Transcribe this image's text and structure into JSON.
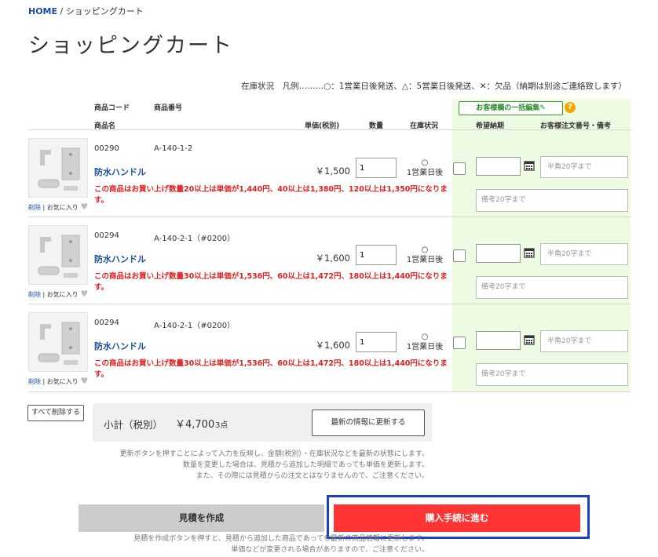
{
  "breadcrumb": {
    "home": "HOME",
    "sep": "/",
    "current": "ショッピングカート"
  },
  "title": "ショッピングカート",
  "legend": "在庫状況　凡例………○：1営業日後発送、△：5営業日後発送、✕：欠品（納期は別途ご連絡致します）",
  "headers": {
    "code": "商品コード",
    "number": "商品番号",
    "name": "商品名",
    "price": "単価(税別)",
    "qty": "数量",
    "stock": "在庫状況",
    "desired_date": "希望納期",
    "order_no": "お客様注文番号・備考",
    "bulk_edit": "お客様欄の一括編集✎",
    "help": "?"
  },
  "items": [
    {
      "code": "00290",
      "number": "A-140-1-2",
      "name": "防水ハンドル",
      "price": "￥1,500",
      "qty": "1",
      "stock_mark": "○",
      "stock_text": "1営業日後",
      "note": "この商品はお買い上げ数量20以上は単価が1,440円、40以上は1,380円、120以上は1,350円になります。",
      "delete": "削除",
      "fav": "お気に入り",
      "order_placeholder": "半角20字まで",
      "memo_placeholder": "備考20字まで"
    },
    {
      "code": "00294",
      "number": "A-140-2-1（#0200）",
      "name": "防水ハンドル",
      "price": "￥1,600",
      "qty": "1",
      "stock_mark": "○",
      "stock_text": "1営業日後",
      "note": "この商品はお買い上げ数量30以上は単価が1,536円、60以上は1,472円、180以上は1,440円になります。",
      "delete": "削除",
      "fav": "お気に入り",
      "order_placeholder": "半角20字まで",
      "memo_placeholder": "備考20字まで"
    },
    {
      "code": "00294",
      "number": "A-140-2-1（#0200）",
      "name": "防水ハンドル",
      "price": "￥1,600",
      "qty": "1",
      "stock_mark": "○",
      "stock_text": "1営業日後",
      "note": "この商品はお買い上げ数量30以上は単価が1,536円、60以上は1,472円、180以上は1,440円になります。",
      "delete": "削除",
      "fav": "お気に入り",
      "order_placeholder": "半角20字まで",
      "memo_placeholder": "備考20字まで"
    }
  ],
  "delete_all": "すべて削除する",
  "subtotal": {
    "label": "小計（税別）",
    "value": "￥4,700",
    "count": "3点",
    "update_button": "最新の情報に更新する"
  },
  "update_note": [
    "更新ボタンを押すことによって入力を反映し、金額(税別）・在庫状況などを最新の状態にします。",
    "数量を変更した場合は、見積から追加した明細であっても単価を更新します。",
    "また、その際には見積からの注文とはなりませんので、ご注意ください。"
  ],
  "estimate_button": "見積を作成",
  "checkout_button": "購入手続に進む",
  "bottom_note": [
    "見積を作成ボタンを押すと、見積から追加した商品であっても最新の商品情報に更新します。",
    "単価などが変更される場合がありますので、ご注意ください。"
  ],
  "colors": {
    "link": "#1a4d9e",
    "accent": "#ff3535",
    "warning": "#e02020",
    "panel": "#eefbe3",
    "focus": "#1a3fc8"
  },
  "icons": {
    "calendar": "calendar-icon",
    "heart": "heart-icon",
    "help": "help-icon",
    "pencil": "pencil-icon"
  }
}
